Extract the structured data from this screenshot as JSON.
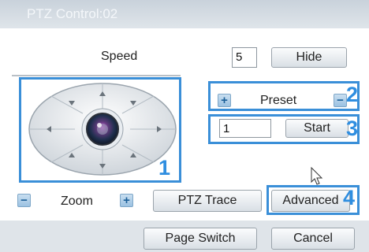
{
  "title": "PTZ Control:02",
  "speed": {
    "label": "Speed",
    "value": "5",
    "hide_label": "Hide"
  },
  "preset": {
    "label": "Preset",
    "plus": "+",
    "minus": "−",
    "value": "1",
    "start_label": "Start"
  },
  "zoom": {
    "label": "Zoom",
    "minus": "−",
    "plus": "+"
  },
  "buttons": {
    "ptz_trace": "PTZ Trace",
    "advanced": "Advanced",
    "page_switch": "Page Switch",
    "cancel": "Cancel"
  },
  "callouts": {
    "n1": "1",
    "n2": "2",
    "n3": "3",
    "n4": "4"
  },
  "colors": {
    "accent": "#3a8fd8"
  }
}
